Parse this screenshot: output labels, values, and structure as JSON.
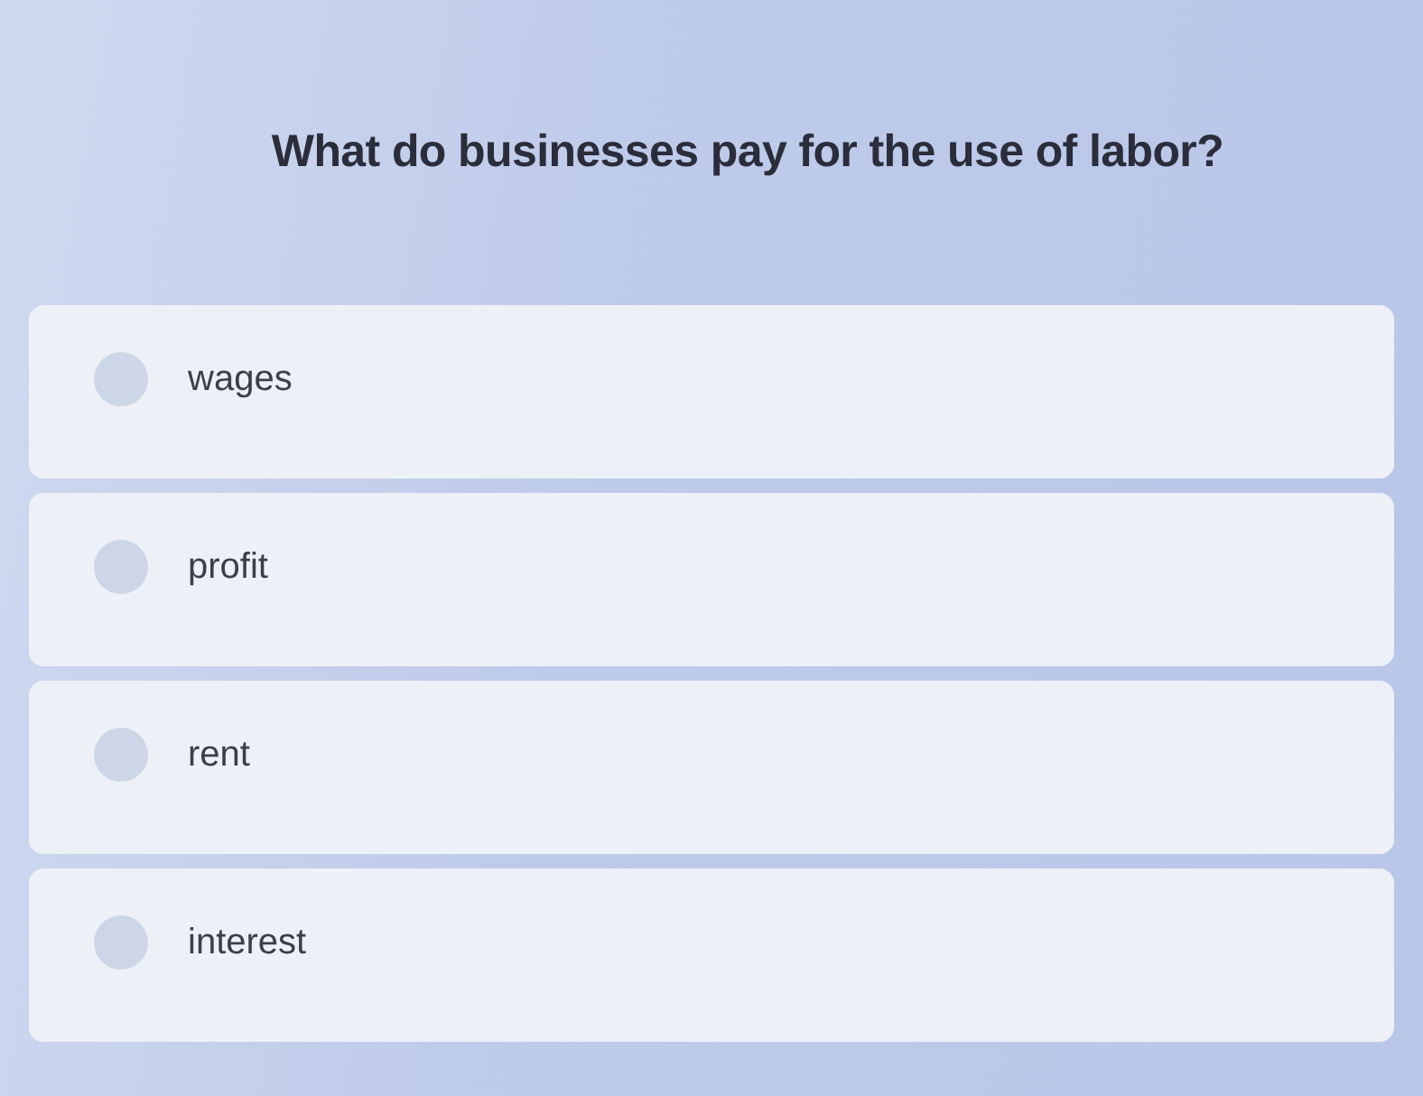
{
  "question": "What do businesses pay for the use of labor?",
  "options": [
    {
      "label": "wages",
      "selected": false
    },
    {
      "label": "profit",
      "selected": false
    },
    {
      "label": "rent",
      "selected": false
    },
    {
      "label": "interest",
      "selected": false
    }
  ]
}
